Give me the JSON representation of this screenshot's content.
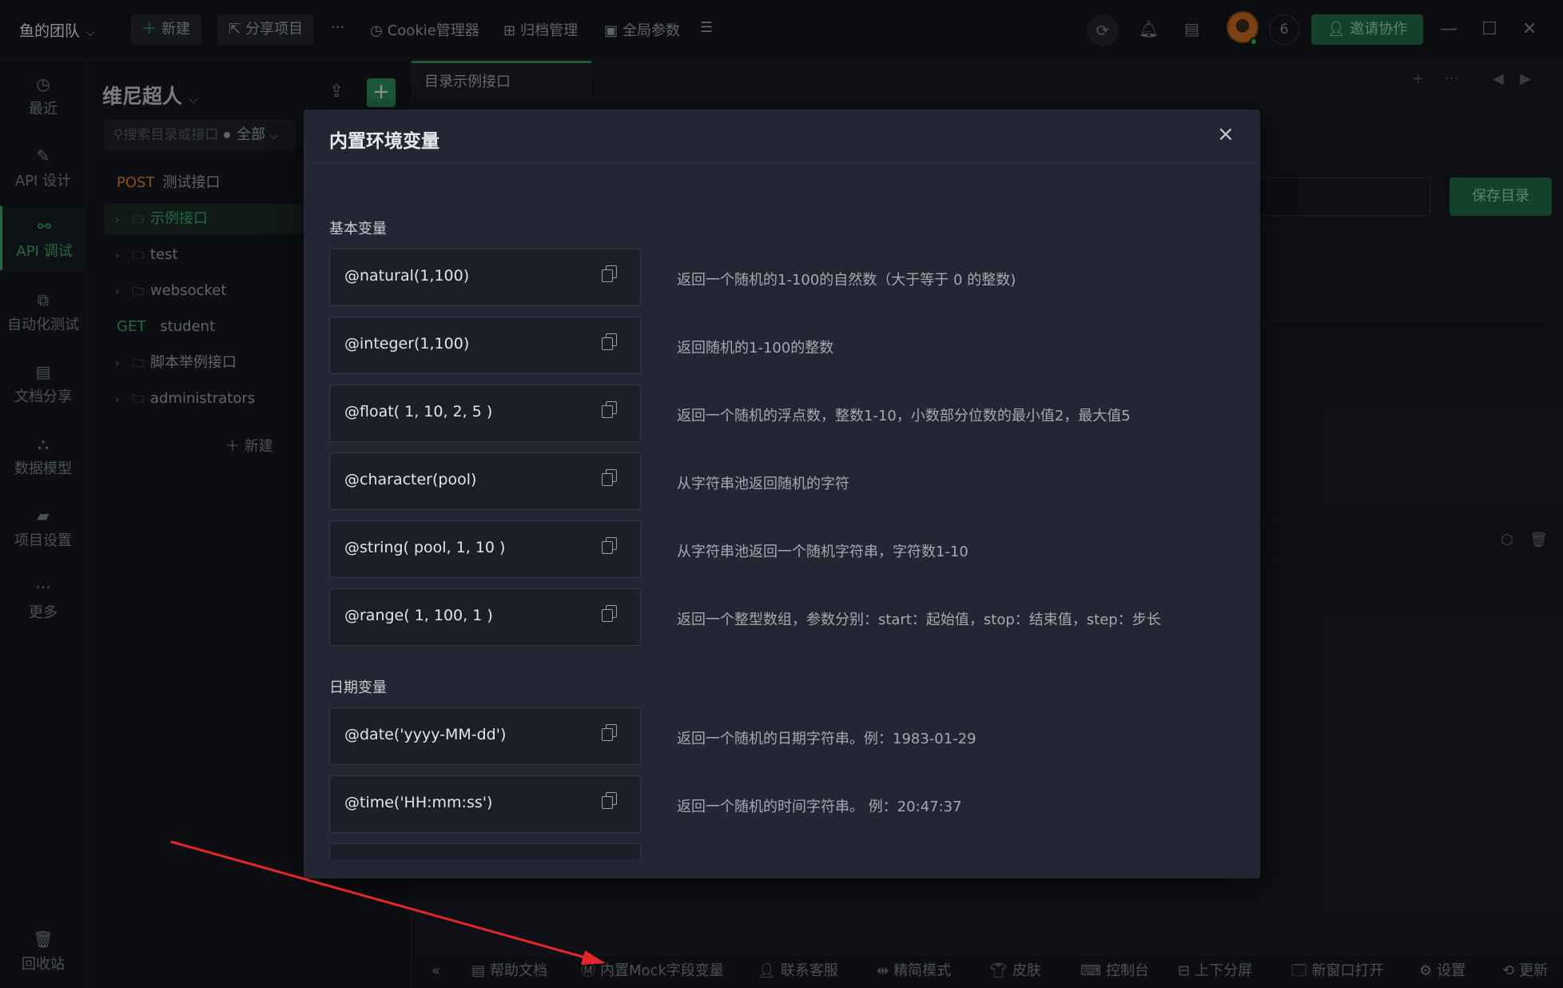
{
  "topbar": {
    "team": "鱼的团队",
    "new_label": "新建",
    "share_label": "分享项目",
    "more": "···",
    "cookie_label": "Cookie管理器",
    "archive_label": "归档管理",
    "global_label": "全局参数",
    "online_count": "6",
    "invite_label": "邀请协作"
  },
  "nav": {
    "recent": "最近",
    "api_design": "API 设计",
    "api_test": "API 调试",
    "auto_test": "自动化测试",
    "doc_share": "文档分享",
    "data_model": "数据模型",
    "project_settings": "项目设置",
    "more": "更多",
    "recycle": "回收站"
  },
  "dirpanel": {
    "project": "维尼超人",
    "search_placeholder": "搜索目录或接口",
    "filter": "全部",
    "tree": [
      {
        "method": "POST",
        "label": "测试接口"
      },
      {
        "label": "示例接口"
      },
      {
        "label": "test"
      },
      {
        "label": "websocket"
      },
      {
        "method": "GET",
        "label": "student"
      },
      {
        "label": "脚本举例接口"
      },
      {
        "label": "administrators"
      }
    ],
    "new_label": "新建"
  },
  "main": {
    "tab": "目录示例接口",
    "save_dir": "保存目录"
  },
  "modal": {
    "title": "内置环境变量",
    "close": "×",
    "sections": [
      {
        "title": "基本变量",
        "items": [
          {
            "code": "@natural(1,100)",
            "desc": "返回一个随机的1-100的自然数（大于等于 0 的整数)"
          },
          {
            "code": "@integer(1,100)",
            "desc": "返回随机的1-100的整数"
          },
          {
            "code": "@float( 1, 10, 2, 5 )",
            "desc": "返回一个随机的浮点数，整数1-10，小数部分位数的最小值2，最大值5"
          },
          {
            "code": "@character(pool)",
            "desc": "从字符串池返回随机的字符"
          },
          {
            "code": "@string( pool, 1, 10 )",
            "desc": "从字符串池返回一个随机字符串，字符数1-10"
          },
          {
            "code": "@range( 1, 100, 1 )",
            "desc": "返回一个整型数组，参数分别：start：起始值，stop：结束值，step：步长"
          }
        ]
      },
      {
        "title": "日期变量",
        "items": [
          {
            "code": "@date('yyyy-MM-dd')",
            "desc": "返回一个随机的日期字符串。例：1983-01-29"
          },
          {
            "code": "@time('HH:mm:ss')",
            "desc": "返回一个随机的时间字符串。 例：20:47:37"
          }
        ]
      }
    ]
  },
  "footer": {
    "collapse": "«",
    "help": "帮助文档",
    "mock": "内置Mock字段变量",
    "support": "联系客服",
    "simple": "精简模式",
    "skin": "皮肤",
    "console": "控制台",
    "split": "上下分屏",
    "new_window": "新窗口打开",
    "settings": "设置",
    "update": "更新"
  },
  "colors": {
    "accent": "#3aa76d",
    "annotation_arrow": "#e3262b",
    "post": "#d9822b"
  }
}
